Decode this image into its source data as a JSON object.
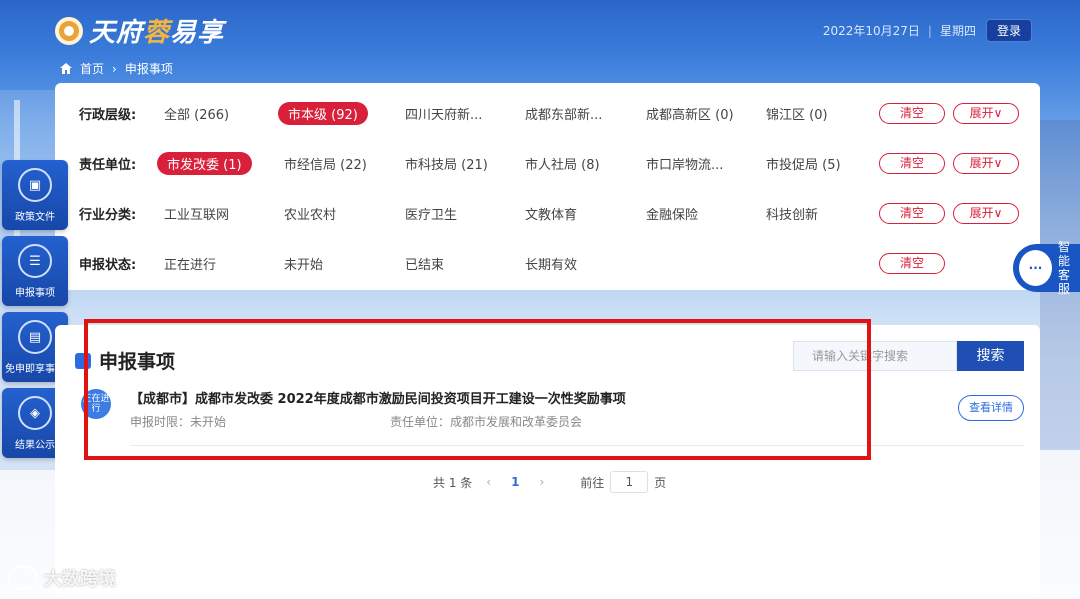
{
  "header": {
    "logo_text_a": "天府",
    "logo_text_b": "蓉",
    "logo_text_c": "易享",
    "date": "2022年10月27日",
    "weekday": "星期四",
    "login_label": "登录"
  },
  "breadcrumb": {
    "home": "首页",
    "current": "申报事项"
  },
  "filters": [
    {
      "label": "行政层级:",
      "options": [
        "全部 (266)",
        "市本级 (92)",
        "四川天府新...",
        "成都东部新...",
        "成都高新区 (0)",
        "锦江区 (0)"
      ],
      "active": 1,
      "clear": "清空",
      "expand": "展开∨"
    },
    {
      "label": "责任单位:",
      "options": [
        "市发改委 (1)",
        "市经信局 (22)",
        "市科技局 (21)",
        "市人社局 (8)",
        "市口岸物流...",
        "市投促局 (5)"
      ],
      "active": 0,
      "clear": "清空",
      "expand": "展开∨"
    },
    {
      "label": "行业分类:",
      "options": [
        "工业互联网",
        "农业农村",
        "医疗卫生",
        "文教体育",
        "金融保险",
        "科技创新"
      ],
      "active": -1,
      "clear": "清空",
      "expand": "展开∨"
    },
    {
      "label": "申报状态:",
      "options": [
        "正在进行",
        "未开始",
        "已结束",
        "长期有效"
      ],
      "active": -1,
      "clear": "清空",
      "expand": ""
    }
  ],
  "side_nav": [
    {
      "label": "政策文件",
      "icon": "document-icon"
    },
    {
      "label": "申报事项",
      "icon": "list-icon"
    },
    {
      "label": "免申即享事项",
      "icon": "gift-icon"
    },
    {
      "label": "结果公示",
      "icon": "announce-icon"
    }
  ],
  "service": {
    "line1": "智能",
    "line2": "客服"
  },
  "list": {
    "title": "申报事项",
    "search_placeholder": "请输入关键字搜索",
    "search_button": "搜索",
    "items": [
      {
        "badge": "正在进行",
        "title": "【成都市】成都市发改委 2022年度成都市激励民间投资项目开工建设一次性奖励事项",
        "deadline": "申报时限：未开始",
        "unit": "责任单位：成都市发展和改革委员会",
        "detail": "查看详情"
      }
    ]
  },
  "pagination": {
    "total": "共 1 条",
    "prev": "‹",
    "current": "1",
    "next": "›",
    "goto": "前往",
    "page_value": "1",
    "page_suffix": "页"
  },
  "watermark": "大数跨境",
  "colors": {
    "accent": "#d9203a",
    "primary": "#1f4fb2",
    "highlight": "#e01313"
  }
}
